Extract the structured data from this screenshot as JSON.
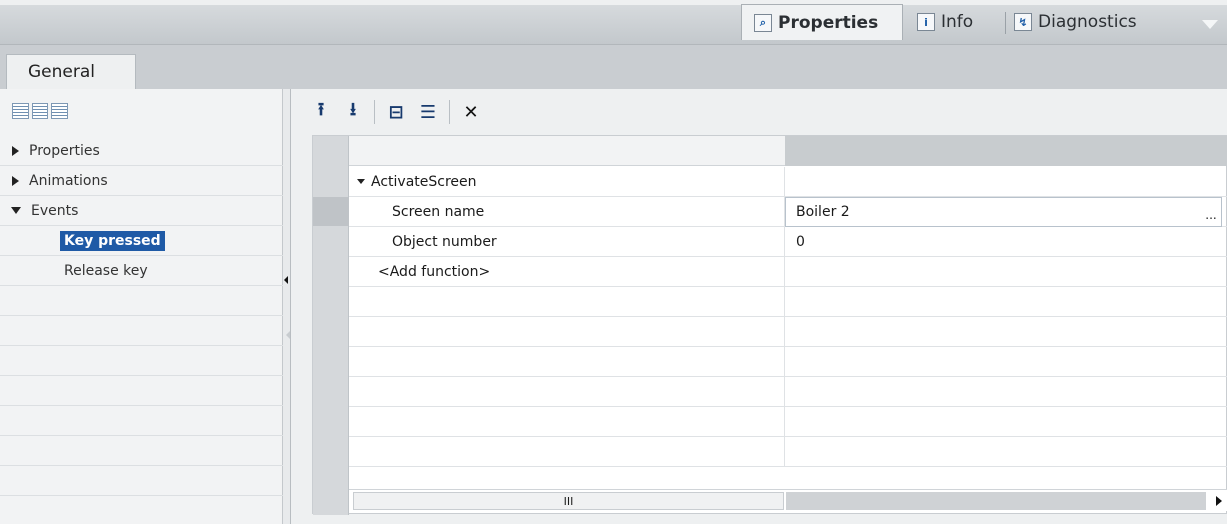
{
  "top_tabs": [
    {
      "label": "Properties",
      "icon": "properties-icon"
    },
    {
      "label": "Info",
      "icon": "info-icon"
    },
    {
      "label": "Diagnostics",
      "icon": "diagnostics-icon"
    }
  ],
  "subtabs": {
    "general": "General"
  },
  "left": {
    "items": [
      {
        "label": "Properties",
        "expanded": false
      },
      {
        "label": "Animations",
        "expanded": false
      },
      {
        "label": "Events",
        "expanded": true
      }
    ],
    "children": [
      {
        "label": "Key pressed",
        "selected": true
      },
      {
        "label": "Release key",
        "selected": false
      }
    ]
  },
  "toolbar": {
    "icons": [
      "move-up-icon",
      "move-down-icon",
      "collapse-all-icon",
      "expand-all-icon",
      "delete-icon"
    ]
  },
  "grid": {
    "function_name": "ActivateScreen",
    "params": [
      {
        "name": "Screen name",
        "value": "Boiler 2"
      },
      {
        "name": "Object number",
        "value": "0"
      }
    ],
    "add_function": "<Add function>",
    "ellipsis": "...",
    "scroll_thumb": "III"
  },
  "colors": {
    "selection": "#1f5aa6",
    "toolbar_icon": "#173a6e"
  }
}
